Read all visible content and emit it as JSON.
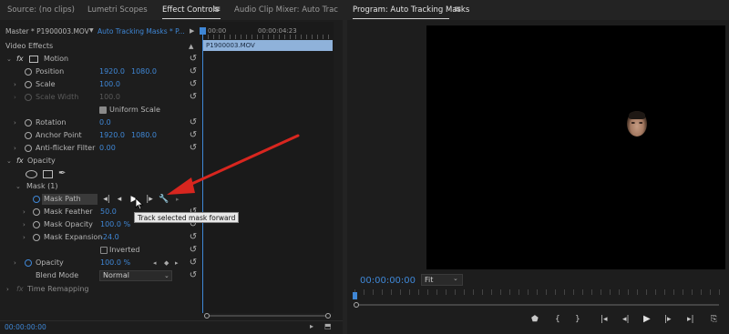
{
  "tabs": {
    "source": "Source: (no clips)",
    "lumetri": "Lumetri Scopes",
    "effect_controls": "Effect Controls",
    "audio_mixer": "Audio Clip Mixer: Auto Trac",
    "program": "Program: Auto Tracking Masks"
  },
  "effect_header": {
    "master": "Master * P1900003.MOV",
    "sequence": "Auto Tracking Masks * P...",
    "time_start": "00:00",
    "time_mark": "00:00:04:23",
    "clip_name": "P1900003.MOV"
  },
  "video_effects_label": "Video Effects",
  "motion": {
    "label": "Motion",
    "properties": [
      {
        "name": "Position",
        "v1": "1920.0",
        "v2": "1080.0"
      },
      {
        "name": "Scale",
        "v1": "100.0",
        "v2": ""
      },
      {
        "name": "Scale Width",
        "v1": "100.0",
        "v2": ""
      },
      {
        "name": "Rotation",
        "v1": "0.0",
        "v2": ""
      },
      {
        "name": "Anchor Point",
        "v1": "1920.0",
        "v2": "1080.0"
      },
      {
        "name": "Anti-flicker Filter",
        "v1": "0.00",
        "v2": ""
      }
    ],
    "uniform_scale": "Uniform Scale"
  },
  "opacity": {
    "label": "Opacity",
    "mask_label": "Mask (1)",
    "mask_path": "Mask Path",
    "mask_feather": {
      "name": "Mask Feather",
      "value": "50.0"
    },
    "mask_opacity": {
      "name": "Mask Opacity",
      "value": "100.0 %"
    },
    "mask_expansion": {
      "name": "Mask Expansion",
      "value": "-24.0"
    },
    "inverted": "Inverted",
    "opacity_prop": {
      "name": "Opacity",
      "value": "100.0 %"
    },
    "blend_mode": {
      "name": "Blend Mode",
      "value": "Normal"
    }
  },
  "time_remapping": "Time Remapping",
  "tooltip": "Track selected mask forward",
  "bottom_timecode": "00:00:00:00",
  "program": {
    "timecode": "00:00:00:00",
    "fit": "Fit"
  },
  "colors": {
    "accent": "#3f87d6",
    "arrow": "#d8261f",
    "clip_bar": "#8fb2da"
  }
}
